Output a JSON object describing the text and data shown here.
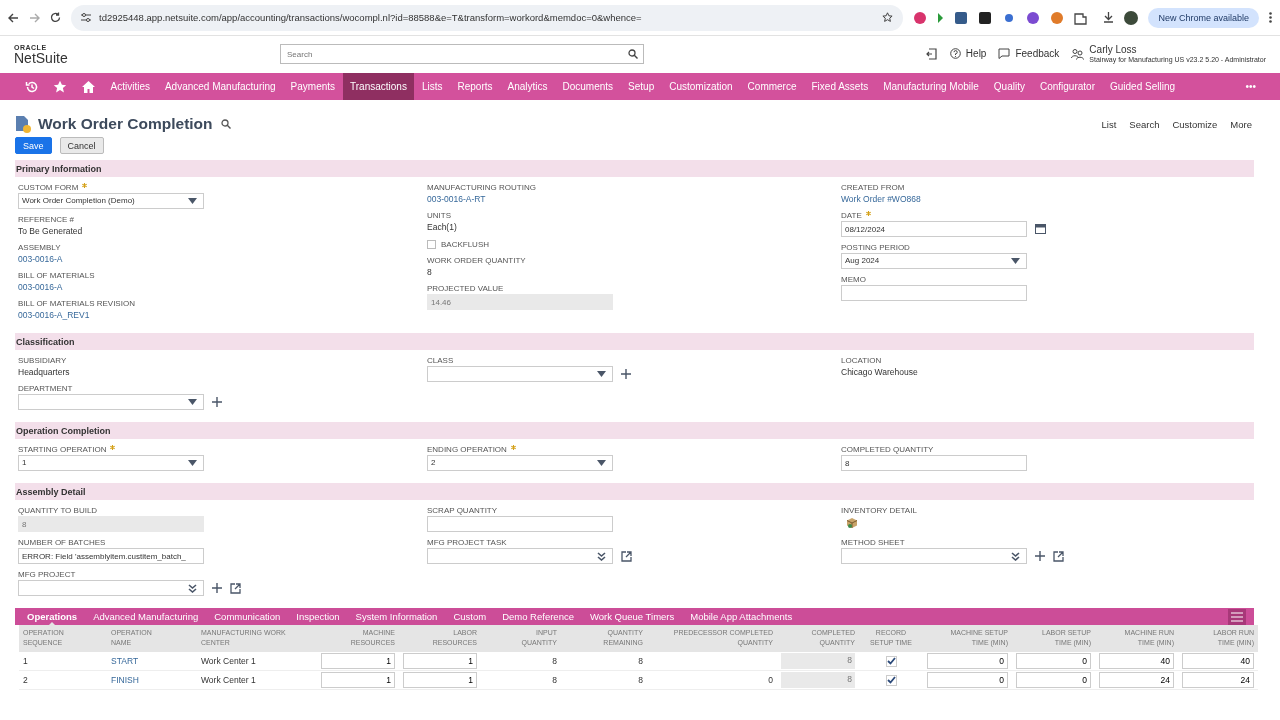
{
  "browser": {
    "url": "td2925448.app.netsuite.com/app/accounting/transactions/wocompl.nl?id=88588&e=T&transform=workord&memdoc=0&whence=",
    "update": "New Chrome available"
  },
  "header": {
    "brand_top": "ORACLE",
    "brand": "NetSuite",
    "search": {
      "placeholder": "Search"
    },
    "help": "Help",
    "feedback": "Feedback",
    "user": "Carly Loss",
    "role": "Stairway for Manufacturing US v23.2 5.20 - Administrator"
  },
  "nav": [
    {
      "label": "Activities",
      "selected": false
    },
    {
      "label": "Advanced Manufacturing",
      "selected": false
    },
    {
      "label": "Payments",
      "selected": false
    },
    {
      "label": "Transactions",
      "selected": true
    },
    {
      "label": "Lists",
      "selected": false
    },
    {
      "label": "Reports",
      "selected": false
    },
    {
      "label": "Analytics",
      "selected": false
    },
    {
      "label": "Documents",
      "selected": false
    },
    {
      "label": "Setup",
      "selected": false
    },
    {
      "label": "Customization",
      "selected": false
    },
    {
      "label": "Commerce",
      "selected": false
    },
    {
      "label": "Fixed Assets",
      "selected": false
    },
    {
      "label": "Manufacturing Mobile",
      "selected": false
    },
    {
      "label": "Quality",
      "selected": false
    },
    {
      "label": "Configurator",
      "selected": false
    },
    {
      "label": "Guided Selling",
      "selected": false
    }
  ],
  "nav_more": "•••",
  "page": {
    "title": "Work Order Completion",
    "actions": [
      "List",
      "Search",
      "Customize",
      "More"
    ],
    "buttons": [
      {
        "label": "Save",
        "kind": "primary"
      },
      {
        "label": "Cancel",
        "kind": "secondary"
      }
    ]
  },
  "sections": [
    {
      "title": "Primary Information",
      "columns": [
        [
          {
            "label": "CUSTOM FORM",
            "required": true,
            "kind": "select",
            "value": "Work Order Completion (Demo)"
          },
          {
            "label": "REFERENCE #",
            "kind": "text",
            "value": "To Be Generated"
          },
          {
            "label": "ASSEMBLY",
            "kind": "text",
            "link": true,
            "value": "003-0016-A"
          },
          {
            "label": "BILL OF MATERIALS",
            "kind": "text",
            "link": true,
            "value": "003-0016-A"
          },
          {
            "label": "BILL OF MATERIALS REVISION",
            "kind": "text",
            "link": true,
            "value": "003-0016-A_REV1"
          }
        ],
        [
          {
            "label": "MANUFACTURING ROUTING",
            "kind": "text",
            "link": true,
            "value": "003-0016-A-RT"
          },
          {
            "label": "UNITS",
            "kind": "text",
            "value": "Each(1)"
          },
          {
            "label": "BACKFLUSH",
            "kind": "checkbox",
            "checked": false
          },
          {
            "label": "WORK ORDER QUANTITY",
            "kind": "text",
            "value": "8"
          },
          {
            "label": "PROJECTED VALUE",
            "kind": "input",
            "disabled": true,
            "value": "14.46"
          }
        ],
        [
          {
            "label": "CREATED FROM",
            "kind": "text",
            "link": true,
            "value": "Work Order #WO868"
          },
          {
            "label": "DATE",
            "required": true,
            "kind": "date",
            "value": "08/12/2024"
          },
          {
            "label": "POSTING PERIOD",
            "kind": "select",
            "value": "Aug 2024"
          },
          {
            "label": "MEMO",
            "kind": "input"
          }
        ]
      ]
    },
    {
      "title": "Classification",
      "columns": [
        [
          {
            "label": "SUBSIDIARY",
            "kind": "text",
            "value": "Headquarters"
          },
          {
            "label": "DEPARTMENT",
            "kind": "select",
            "add": true
          }
        ],
        [
          {
            "label": "CLASS",
            "kind": "select",
            "add": true
          }
        ],
        [
          {
            "label": "LOCATION",
            "kind": "text",
            "value": "Chicago Warehouse"
          }
        ]
      ]
    },
    {
      "title": "Operation Completion",
      "columns": [
        [
          {
            "label": "STARTING OPERATION",
            "required": true,
            "kind": "select",
            "value": "1"
          }
        ],
        [
          {
            "label": "ENDING OPERATION",
            "required": true,
            "kind": "select",
            "value": "2"
          }
        ],
        [
          {
            "label": "COMPLETED QUANTITY",
            "kind": "input",
            "value": "8"
          }
        ]
      ]
    },
    {
      "title": "Assembly Detail",
      "columns": [
        [
          {
            "label": "QUANTITY TO BUILD",
            "kind": "input",
            "disabled": true,
            "value": "8"
          },
          {
            "label": "NUMBER OF BATCHES",
            "kind": "input",
            "value": "ERROR: Field 'assemblyitem.custitem_batch_"
          },
          {
            "label": "MFG PROJECT",
            "kind": "multiselect",
            "add": true,
            "open": true
          }
        ],
        [
          {
            "label": "SCRAP QUANTITY",
            "kind": "input"
          },
          {
            "label": "MFG PROJECT TASK",
            "kind": "multiselect",
            "open": true
          }
        ],
        [
          {
            "label": "INVENTORY DETAIL",
            "kind": "icon"
          },
          {
            "label": "METHOD SHEET",
            "kind": "multiselect",
            "add": true,
            "open": true
          }
        ]
      ]
    }
  ],
  "subtabs": [
    {
      "label": "Operations",
      "selected": true
    },
    {
      "label": "Advanced Manufacturing",
      "selected": false
    },
    {
      "label": "Communication",
      "selected": false
    },
    {
      "label": "Inspection",
      "selected": false
    },
    {
      "label": "System Information",
      "selected": false
    },
    {
      "label": "Custom",
      "selected": false
    },
    {
      "label": "Demo Reference",
      "selected": false
    },
    {
      "label": "Work Queue Timers",
      "selected": false
    },
    {
      "label": "Mobile App Attachments",
      "selected": false
    }
  ],
  "table": {
    "columns": [
      {
        "lines": [
          "OPERATION",
          "SEQUENCE"
        ]
      },
      {
        "lines": [
          "OPERATION",
          "NAME"
        ]
      },
      {
        "lines": [
          "MANUFACTURING WORK",
          "CENTER"
        ]
      },
      {
        "lines": [
          "MACHINE",
          "RESOURCES"
        ]
      },
      {
        "lines": [
          "LABOR",
          "RESOURCES"
        ]
      },
      {
        "lines": [
          "INPUT",
          "QUANTITY"
        ]
      },
      {
        "lines": [
          "QUANTITY",
          "REMAINING"
        ]
      },
      {
        "lines": [
          "PREDECESSOR COMPLETED",
          "QUANTITY"
        ]
      },
      {
        "lines": [
          "COMPLETED",
          "QUANTITY"
        ]
      },
      {
        "lines": [
          "RECORD",
          "SETUP TIME"
        ]
      },
      {
        "lines": [
          "MACHINE SETUP",
          "TIME (MIN)"
        ]
      },
      {
        "lines": [
          "LABOR SETUP",
          "TIME (MIN)"
        ]
      },
      {
        "lines": [
          "MACHINE RUN",
          "TIME (MIN)"
        ]
      },
      {
        "lines": [
          "LABOR RUN",
          "TIME (MIN)"
        ]
      }
    ],
    "rows": [
      [
        {
          "kind": "text",
          "value": "1"
        },
        {
          "kind": "link",
          "value": "START"
        },
        {
          "kind": "text",
          "value": "Work Center 1"
        },
        {
          "kind": "input",
          "value": "1"
        },
        {
          "kind": "input",
          "value": "1"
        },
        {
          "kind": "text",
          "value": "8"
        },
        {
          "kind": "text",
          "value": "8"
        },
        {
          "kind": "blank"
        },
        {
          "kind": "readonly",
          "value": "8"
        },
        {
          "kind": "check",
          "checked": true
        },
        {
          "kind": "input",
          "value": "0"
        },
        {
          "kind": "input",
          "value": "0"
        },
        {
          "kind": "input",
          "value": "40"
        },
        {
          "kind": "input",
          "value": "40"
        }
      ],
      [
        {
          "kind": "text",
          "value": "2"
        },
        {
          "kind": "link",
          "value": "FINISH"
        },
        {
          "kind": "text",
          "value": "Work Center 1"
        },
        {
          "kind": "input",
          "value": "1"
        },
        {
          "kind": "input",
          "value": "1"
        },
        {
          "kind": "text",
          "value": "8"
        },
        {
          "kind": "text",
          "value": "8"
        },
        {
          "kind": "text",
          "value": "0"
        },
        {
          "kind": "readonly",
          "value": "8"
        },
        {
          "kind": "check",
          "checked": true
        },
        {
          "kind": "input",
          "value": "0"
        },
        {
          "kind": "input",
          "value": "0"
        },
        {
          "kind": "input",
          "value": "24"
        },
        {
          "kind": "input",
          "value": "24"
        }
      ]
    ]
  }
}
